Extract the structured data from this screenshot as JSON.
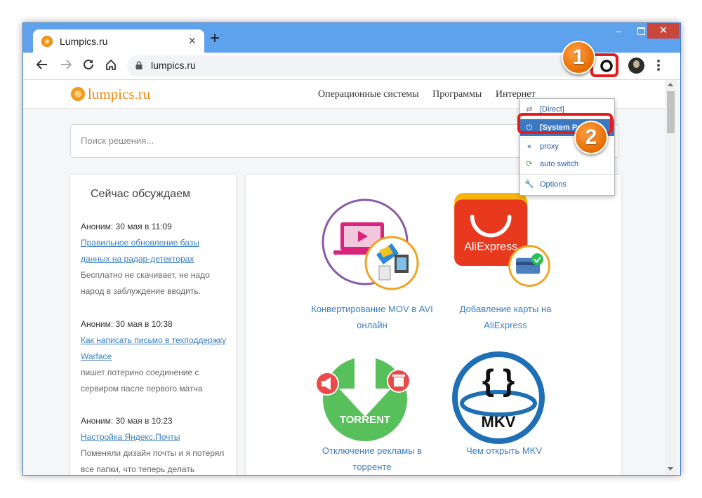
{
  "browser": {
    "tab_title": "Lumpics.ru",
    "tab_close": "×",
    "new_tab": "+",
    "address": "lumpics.ru",
    "window_controls": {
      "minimize": "–",
      "close": "✕"
    }
  },
  "site": {
    "logo_text": "lumpics.ru",
    "menu": [
      "Операционные системы",
      "Программы",
      "Интернет"
    ],
    "search_placeholder": "Поиск решения..."
  },
  "sidebar": {
    "heading": "Сейчас обсуждаем",
    "posts": [
      {
        "meta": "Аноним: 30 мая в 11:09",
        "link": "Правильное обновление базы данных на радар-детекторах",
        "snippet": "Бесплатно не скачивает, не надо народ в заблуждение вводить."
      },
      {
        "meta": "Аноним: 30 мая в 10:38",
        "link": "Как написать письмо в техподдержку Warface",
        "snippet": "пишет потерино соединение с сервиром пасле первого матча"
      },
      {
        "meta": "Аноним: 30 мая в 10:23",
        "link": "Настройка Яндекс.Почты",
        "snippet": "Поменяли дизайн почты и я потерял все папки, что теперь делать"
      }
    ]
  },
  "articles": [
    {
      "caption": "Конвертирование MOV в AVI онлайн",
      "icon": "video-convert-icon"
    },
    {
      "caption": "Добавление карты на AliExpress",
      "icon": "aliexpress-icon",
      "icon_text": "AliExpress"
    },
    {
      "caption": "Отключение рекламы в торренте",
      "icon": "torrent-icon",
      "icon_text": "TORRENT"
    },
    {
      "caption": "Чем открыть MKV",
      "icon": "mkv-icon",
      "icon_text": "MKV"
    }
  ],
  "proxy_menu": {
    "items": [
      {
        "label": "[Direct]",
        "icon": "direct-icon",
        "selected": false
      },
      {
        "label": "[System Proxy]",
        "icon": "power-icon",
        "selected": true
      },
      {
        "label": "proxy",
        "icon": "globe-icon",
        "selected": false
      },
      {
        "label": "auto switch",
        "icon": "auto-switch-icon",
        "selected": false
      },
      {
        "label": "Options",
        "icon": "wrench-icon",
        "selected": false
      }
    ]
  },
  "annotations": {
    "step1": "1",
    "step2": "2"
  },
  "colors": {
    "titlebar": "#5ea2ee",
    "callout": "#e81b1b",
    "badge": "#f08a14",
    "link": "#3a7fc1",
    "selected": "#3b78c4"
  }
}
